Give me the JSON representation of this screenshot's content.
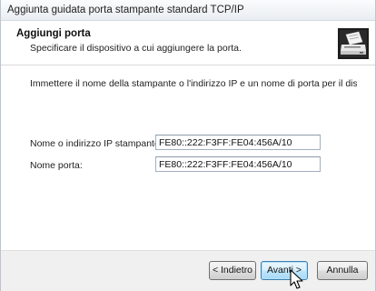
{
  "window": {
    "title": "Aggiunta guidata porta stampante standard TCP/IP"
  },
  "header": {
    "title": "Aggiungi porta",
    "subtitle": "Specificare il dispositivo a cui aggiungere la porta.",
    "icon": "printer-icon"
  },
  "main": {
    "instruction": "Immettere il nome della stampante o l'indirizzo IP e un nome di porta per il dispositivo selezionato.",
    "ip_label": "Nome o indirizzo IP stampante:",
    "ip_value": "FE80::222:F3FF:FE04:456A/10",
    "port_label": "Nome porta:",
    "port_value": "FE80::222:F3FF:FE04:456A/10"
  },
  "footer": {
    "back_label": "< Indietro",
    "next_label": "Avanti >",
    "cancel_label": "Annulla"
  },
  "colors": {
    "title_bar": "#e9edf2",
    "footer_bg": "#f0f0f0",
    "default_button_border": "#3c7fb1"
  }
}
